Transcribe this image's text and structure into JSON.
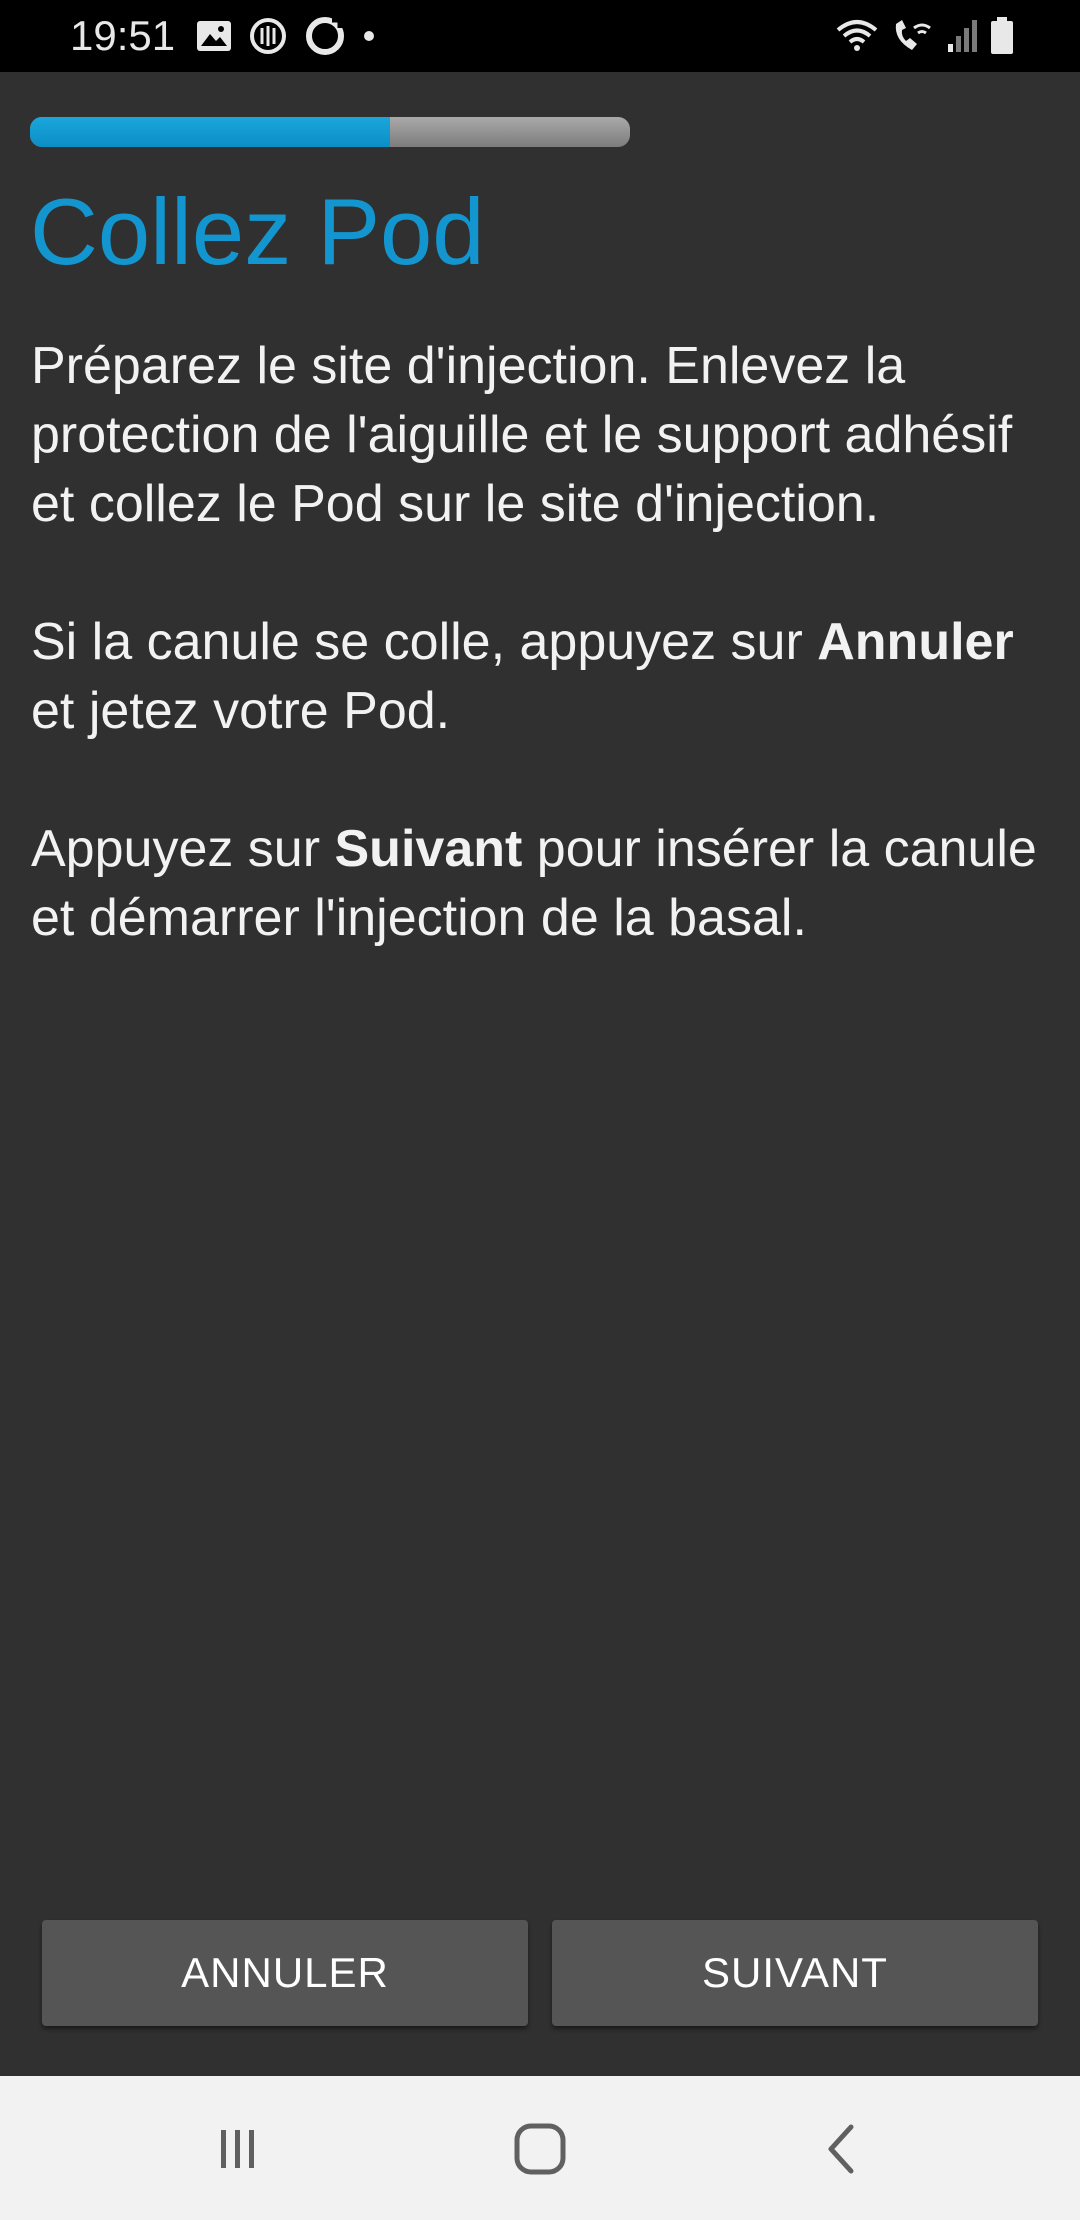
{
  "status_bar": {
    "time": "19:51",
    "icons_left": [
      "gallery-icon",
      "sync-icon",
      "circle-app-icon",
      "dot-icon"
    ],
    "icons_right": [
      "wifi-icon",
      "wifi-calling-icon",
      "signal-icon",
      "battery-icon"
    ]
  },
  "progress": {
    "fraction": 0.6,
    "fill_color": "#1396cf",
    "track_color": "#8e8e8e"
  },
  "screen": {
    "title": "Collez Pod",
    "title_color": "#1396cf",
    "p1": "Préparez le site d'injection. Enlevez la protection de l'aiguille et le support adhésif et collez le Pod sur le site d'injection.",
    "p2_before": "Si la canule se colle, appuyez sur ",
    "p2_bold": "Annuler",
    "p2_after": " et jetez votre Pod.",
    "p3_before": "Appuyez sur ",
    "p3_bold": "Suivant",
    "p3_after": " pour insérer la canule et démarrer l'injection de la basal."
  },
  "buttons": {
    "cancel_label": "ANNULER",
    "next_label": "SUIVANT"
  },
  "nav_bar": {
    "items": [
      "recent-apps-icon",
      "home-icon",
      "back-icon"
    ]
  }
}
